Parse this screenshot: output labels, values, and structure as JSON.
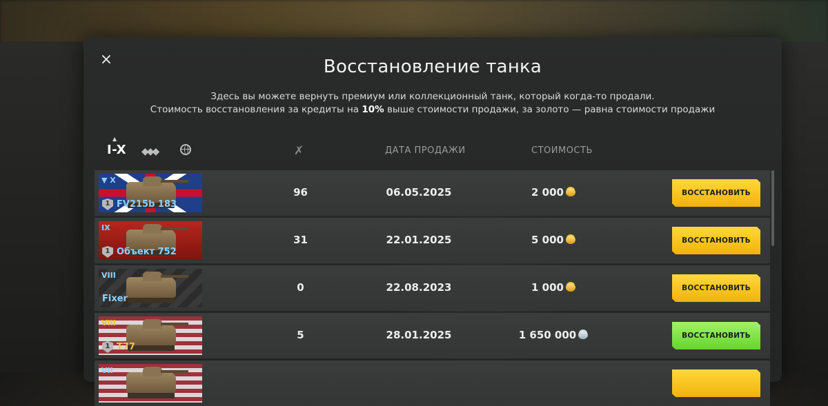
{
  "modal": {
    "close_icon": "×",
    "title": "Восстановление танка",
    "desc_line1": "Здесь вы можете вернуть премиум или коллекционный танк, который когда-то продали.",
    "desc_line2_a": "Стоимость восстановления за кредиты на ",
    "desc_line2_b": "10%",
    "desc_line2_c": " выше стоимости продажи, за золото — равна стоимости продажи"
  },
  "filters": {
    "tier_label": "I-X",
    "sort_caret": "▲",
    "class_icon": "class-filter-icon",
    "nation_icon": "nation-filter-icon"
  },
  "columns": {
    "battles_icon": "✗",
    "date": "ДАТА ПРОДАЖИ",
    "cost": "СТОИМОСТЬ"
  },
  "rows": [
    {
      "tier": "▼ X",
      "name": "FV215b 183",
      "shield": "1",
      "battles": "96",
      "date": "06.05.2025",
      "cost": "2 000",
      "currency": "gold",
      "button": "ВОССТАНОВИТЬ",
      "button_color": "yellow",
      "flag": "uk",
      "name_color": "blue"
    },
    {
      "tier": "IX",
      "name": "Объект 752",
      "shield": "1",
      "battles": "31",
      "date": "22.01.2025",
      "cost": "5 000",
      "currency": "gold",
      "button": "ВОССТАНОВИТЬ",
      "button_color": "yellow",
      "flag": "ussr",
      "name_color": "blue"
    },
    {
      "tier": "VIII",
      "name": "Fixer",
      "shield": "",
      "battles": "0",
      "date": "22.08.2023",
      "cost": "1 000",
      "currency": "gold",
      "button": "ВОССТАНОВИТЬ",
      "button_color": "yellow",
      "flag": "dark",
      "name_color": "blue"
    },
    {
      "tier": "VIII",
      "name": "T77",
      "shield": "1",
      "battles": "5",
      "date": "28.01.2025",
      "cost": "1 650 000",
      "currency": "silver",
      "button": "ВОССТАНОВИТЬ",
      "button_color": "green",
      "flag": "usa",
      "name_color": "gold"
    },
    {
      "tier": "VII",
      "name": "",
      "shield": "",
      "battles": "",
      "date": "",
      "cost": "",
      "currency": "",
      "button": "",
      "button_color": "yellow",
      "flag": "usa",
      "name_color": "blue"
    }
  ],
  "colors": {
    "accent_yellow": "#f7c81e",
    "accent_green": "#7de240",
    "tier_blue": "#8fd0ff",
    "tier_gold": "#f3c23a"
  }
}
